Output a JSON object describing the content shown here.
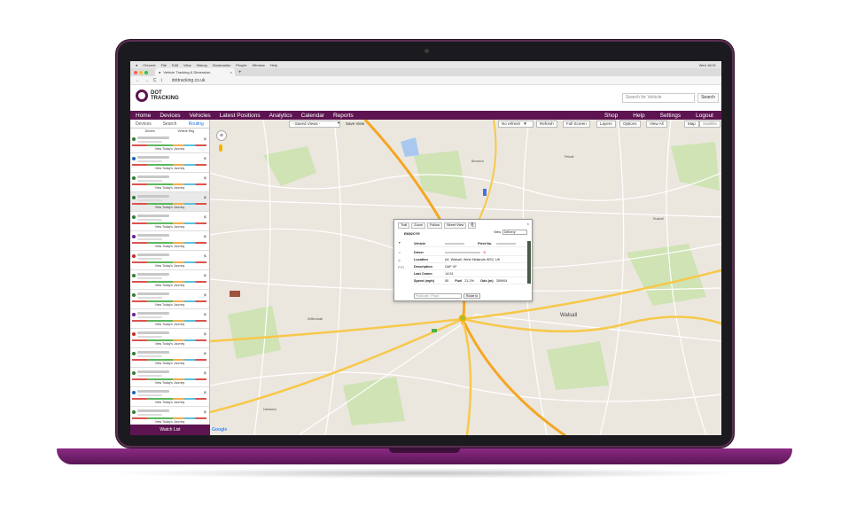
{
  "browser": {
    "menubar": [
      "Chrome",
      "File",
      "Edit",
      "View",
      "History",
      "Bookmarks",
      "People",
      "Window",
      "Help"
    ],
    "clock": "Wed 16:01",
    "tab_title": "Vehicle Tracking & Dimension",
    "tab_close": "×",
    "new_tab": "+",
    "url": "dottracking.co.uk",
    "nav_back": "←",
    "nav_forward": "→",
    "nav_reload": "C",
    "url_icon": "i"
  },
  "site": {
    "logo_line1": "DOT",
    "logo_line2": "TRACKING",
    "search_placeholder": "Search for Vehicle",
    "search_button": "Search"
  },
  "nav": {
    "left": [
      "Home",
      "Devices",
      "Vehicles",
      "Latest Positions",
      "Analytics",
      "Calendar",
      "Reports"
    ],
    "right": [
      "Shop",
      "Help",
      "Settings",
      "Logout"
    ]
  },
  "left_panel": {
    "tabs": [
      "Devices",
      "Search",
      "Routing"
    ],
    "active_tab": "Routing",
    "col_headers": [
      "Drivers",
      "Vehicle Reg"
    ],
    "journey_link": "View Today's Journey",
    "arrow": "≶",
    "vehicles": [
      {
        "icon_color": "#2e7d32"
      },
      {
        "icon_color": "#1565c0"
      },
      {
        "icon_color": "#2e7d32"
      },
      {
        "icon_color": "#2e7d32"
      },
      {
        "icon_color": "#2e7d32"
      },
      {
        "icon_color": "#6a1b9a"
      },
      {
        "icon_color": "#c62828"
      },
      {
        "icon_color": "#2e7d32"
      },
      {
        "icon_color": "#2e7d32"
      },
      {
        "icon_color": "#6a1b9a"
      },
      {
        "icon_color": "#c62828"
      },
      {
        "icon_color": "#2e7d32"
      },
      {
        "icon_color": "#2e7d32"
      },
      {
        "icon_color": "#1565c0"
      },
      {
        "icon_color": "#2e7d32"
      }
    ],
    "watch_list": "Watch List"
  },
  "map": {
    "saved_views": "- Saved Views -",
    "saved_views_arrow": "▼",
    "save_view": "Save View",
    "refresh_select": "No refresh",
    "refresh_arrow": "▼",
    "buttons": [
      "Refresh",
      "Full Screen",
      "Layers",
      "Options",
      "View All",
      "Map",
      "Satellite"
    ],
    "pan_control": "⊕",
    "google": "Google"
  },
  "popup": {
    "actions": [
      "Trail",
      "Zoom",
      "Follow",
      "Street View"
    ],
    "copy_icon": "⎘",
    "close": "×",
    "view_label": "View",
    "view_select": "Delivery",
    "registration": "EM02CYE",
    "rows": [
      {
        "key": "Vehicle",
        "value": "",
        "extra_key": "Fleet No.",
        "extra_value": ""
      },
      {
        "key": "Driver",
        "value": "",
        "extra_key": "",
        "extra_value": ""
      },
      {
        "key": "Location",
        "value": "A4, Walsall, West Midlands WS2, UK",
        "extra_key": "",
        "extra_value": ""
      },
      {
        "key": "Description",
        "value": "DAF XF",
        "extra_key": "",
        "extra_value": ""
      },
      {
        "key": "Last Comm",
        "value": "14:51",
        "extra_key": "",
        "extra_value": ""
      },
      {
        "key": "Speed (mph)",
        "value": "50",
        "extra_key": "Fuel",
        "extra_value": "21.2%"
      }
    ],
    "odo_label": "Odo (m)",
    "odo_value": "359904",
    "postcode_placeholder": "Postcode / Place",
    "route_button": "Route to",
    "pto": "PTO"
  },
  "map_labels": [
    "Willenhall",
    "Walsall",
    "Bloxwich",
    "Darlaston",
    "Rushall",
    "Pelsall"
  ]
}
